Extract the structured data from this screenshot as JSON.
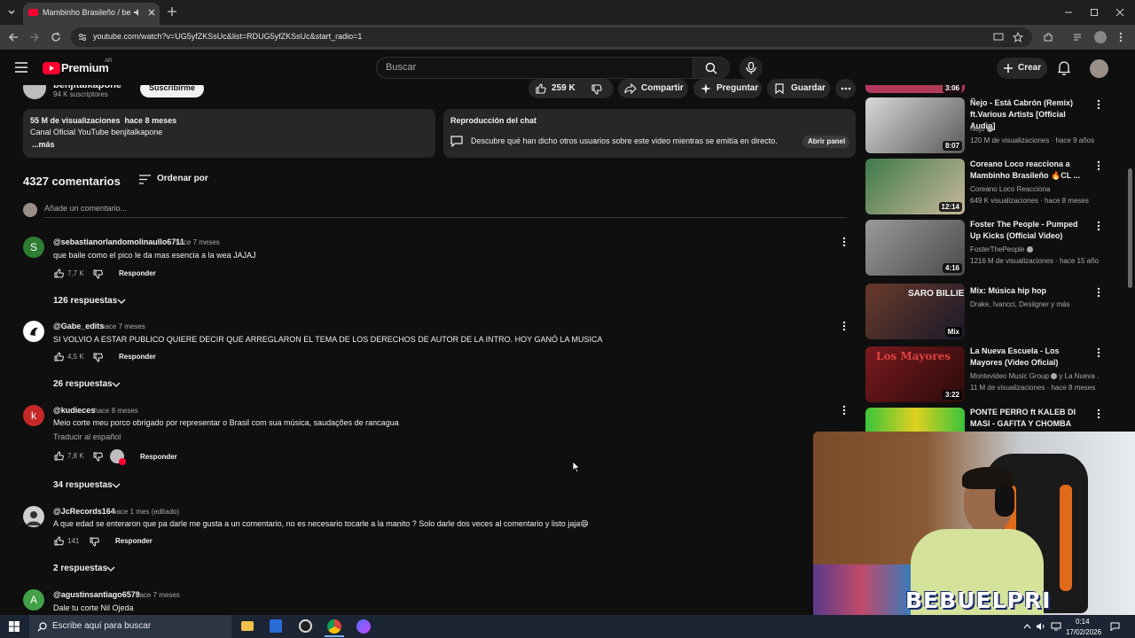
{
  "browser": {
    "tab_title": "Mambinho Brasileño / benjitalkapone",
    "url": "youtube.com/watch?v=UG5yfZKSsUc&list=RDUG5yfZKSsUc&start_radio=1"
  },
  "youtube": {
    "logo_text": "Premium",
    "region": "AR",
    "search_placeholder": "Buscar",
    "create_label": "Crear"
  },
  "channel": {
    "name": "benjitalkapone",
    "subscribers": "94 K suscriptores",
    "subscribe_label": "Suscribirme"
  },
  "actions": {
    "likes": "259 K",
    "share": "Compartir",
    "ask": "Preguntar",
    "save": "Guardar"
  },
  "description": {
    "views_time": "55 M de visualizaciones  hace 8 meses",
    "line": "Canal Oficial YouTube benjitalkapone",
    "more": "...más"
  },
  "chat_replay": {
    "title": "Reproducción del chat",
    "text": "Descubre qué han dicho otros usuarios sobre este video mientras se emitía en directo.",
    "button": "Abrir panel"
  },
  "comments": {
    "count_label": "4327 comentarios",
    "sort_label": "Ordenar por",
    "add_placeholder": "Añade un comentario...",
    "respond_label": "Responder",
    "items": [
      {
        "initial": "S",
        "color": "#2e7d32",
        "author": "@sebastianorlandomolinaullo6711",
        "time": "hace 7 meses",
        "text": "que baile como el pico le da mas esencia a la wea JAJAJ",
        "likes": "7,7 K",
        "replies": "126 respuestas"
      },
      {
        "initial": "",
        "color": "#ffffff",
        "author": "@Gabe_edits",
        "time": "hace 7 meses",
        "text": "SI VOLVIO A ESTAR PUBLICO QUIERE DECIR QUE ARREGLARON EL TEMA DE LOS DERECHOS DE AUTOR DE LA INTRO. HOY GANÓ LA MUSICA",
        "likes": "4,5 K",
        "replies": "26 respuestas"
      },
      {
        "initial": "k",
        "color": "#c62828",
        "author": "@kudieces",
        "time": "hace 8 meses",
        "text": "Meio corte meu porco obrigado por representar o Brasil com sua música, saudações de rancagua",
        "translate": "Traducir al español",
        "likes": "7,8 K",
        "replies": "34 respuestas"
      },
      {
        "initial": "",
        "color": "#cfcfcf",
        "author": "@JcRecords164",
        "time": "hace 1 mes (editado)",
        "text": "A que edad se enteraron que pa darle me gusta a un comentario, no es necesario tocarle a la manito ? Solo darle dos veces al comentario y listo jaja😄",
        "likes": "141",
        "replies": "2 respuestas"
      },
      {
        "initial": "A",
        "color": "#43a047",
        "author": "@agustinsantiago6579",
        "time": "hace 7 meses",
        "text": "Dale tu corte Nil Ojeda"
      }
    ]
  },
  "recommendations": [
    {
      "title": "Ñejo - Está Cabrón (Remix) ft.Various Artists [Official Audio]",
      "channel": "Ñejo",
      "meta": "120 M de visualizaciones · hace 9 años",
      "duration": "8:07",
      "thumb_color": "#cfcfcf"
    },
    {
      "title": "Coreano Loco reacciona a Mambinho Brasileño 🔥CL ...",
      "channel": "Coreano Loco Reacciona",
      "meta": "649 K visualizaciones · hace 8 meses",
      "duration": "12:14",
      "thumb_color": "#3f7a4a"
    },
    {
      "title": "Foster The People - Pumped Up Kicks (Official Video)",
      "channel": "FosterThePeople",
      "meta": "1216 M de visualizaciones · hace 15 años",
      "duration": "4:16",
      "thumb_color": "#8a8a8a"
    },
    {
      "title": "Mix: Música hip hop",
      "channel": "Drake, Ivancci, Desiigner y más",
      "meta": "",
      "duration": "Mix",
      "thumb_color": "#3a2a20",
      "overlay": "SARO  BILLIE JEAN"
    },
    {
      "title": "La Nueva Escuela - Los Mayores (Video Oficial)",
      "channel": "Montevideo Music Group",
      "meta": "11 M de visualizaciones · hace 8 meses",
      "channel_extra": "y La Nueva ...",
      "duration": "3:22",
      "thumb_color": "#5a0e12",
      "overlay": "Los Mayores"
    },
    {
      "title": "PONTE PERRO ft KALEB DI MASI - GAFITA Y CHOMBA",
      "channel": "",
      "meta": "",
      "duration": "",
      "thumb_color": "#c9c12a"
    }
  ],
  "partial_top_duration": "3:06",
  "webcam": {
    "overlay_name": "BEBUELPRI"
  },
  "taskbar": {
    "search_placeholder": "Escribe aquí para buscar",
    "time": "0:14",
    "date": "17/02/2026"
  },
  "colors": {
    "youtube_red": "#ff0033",
    "background": "#0f0f0f",
    "panel": "#272727"
  }
}
